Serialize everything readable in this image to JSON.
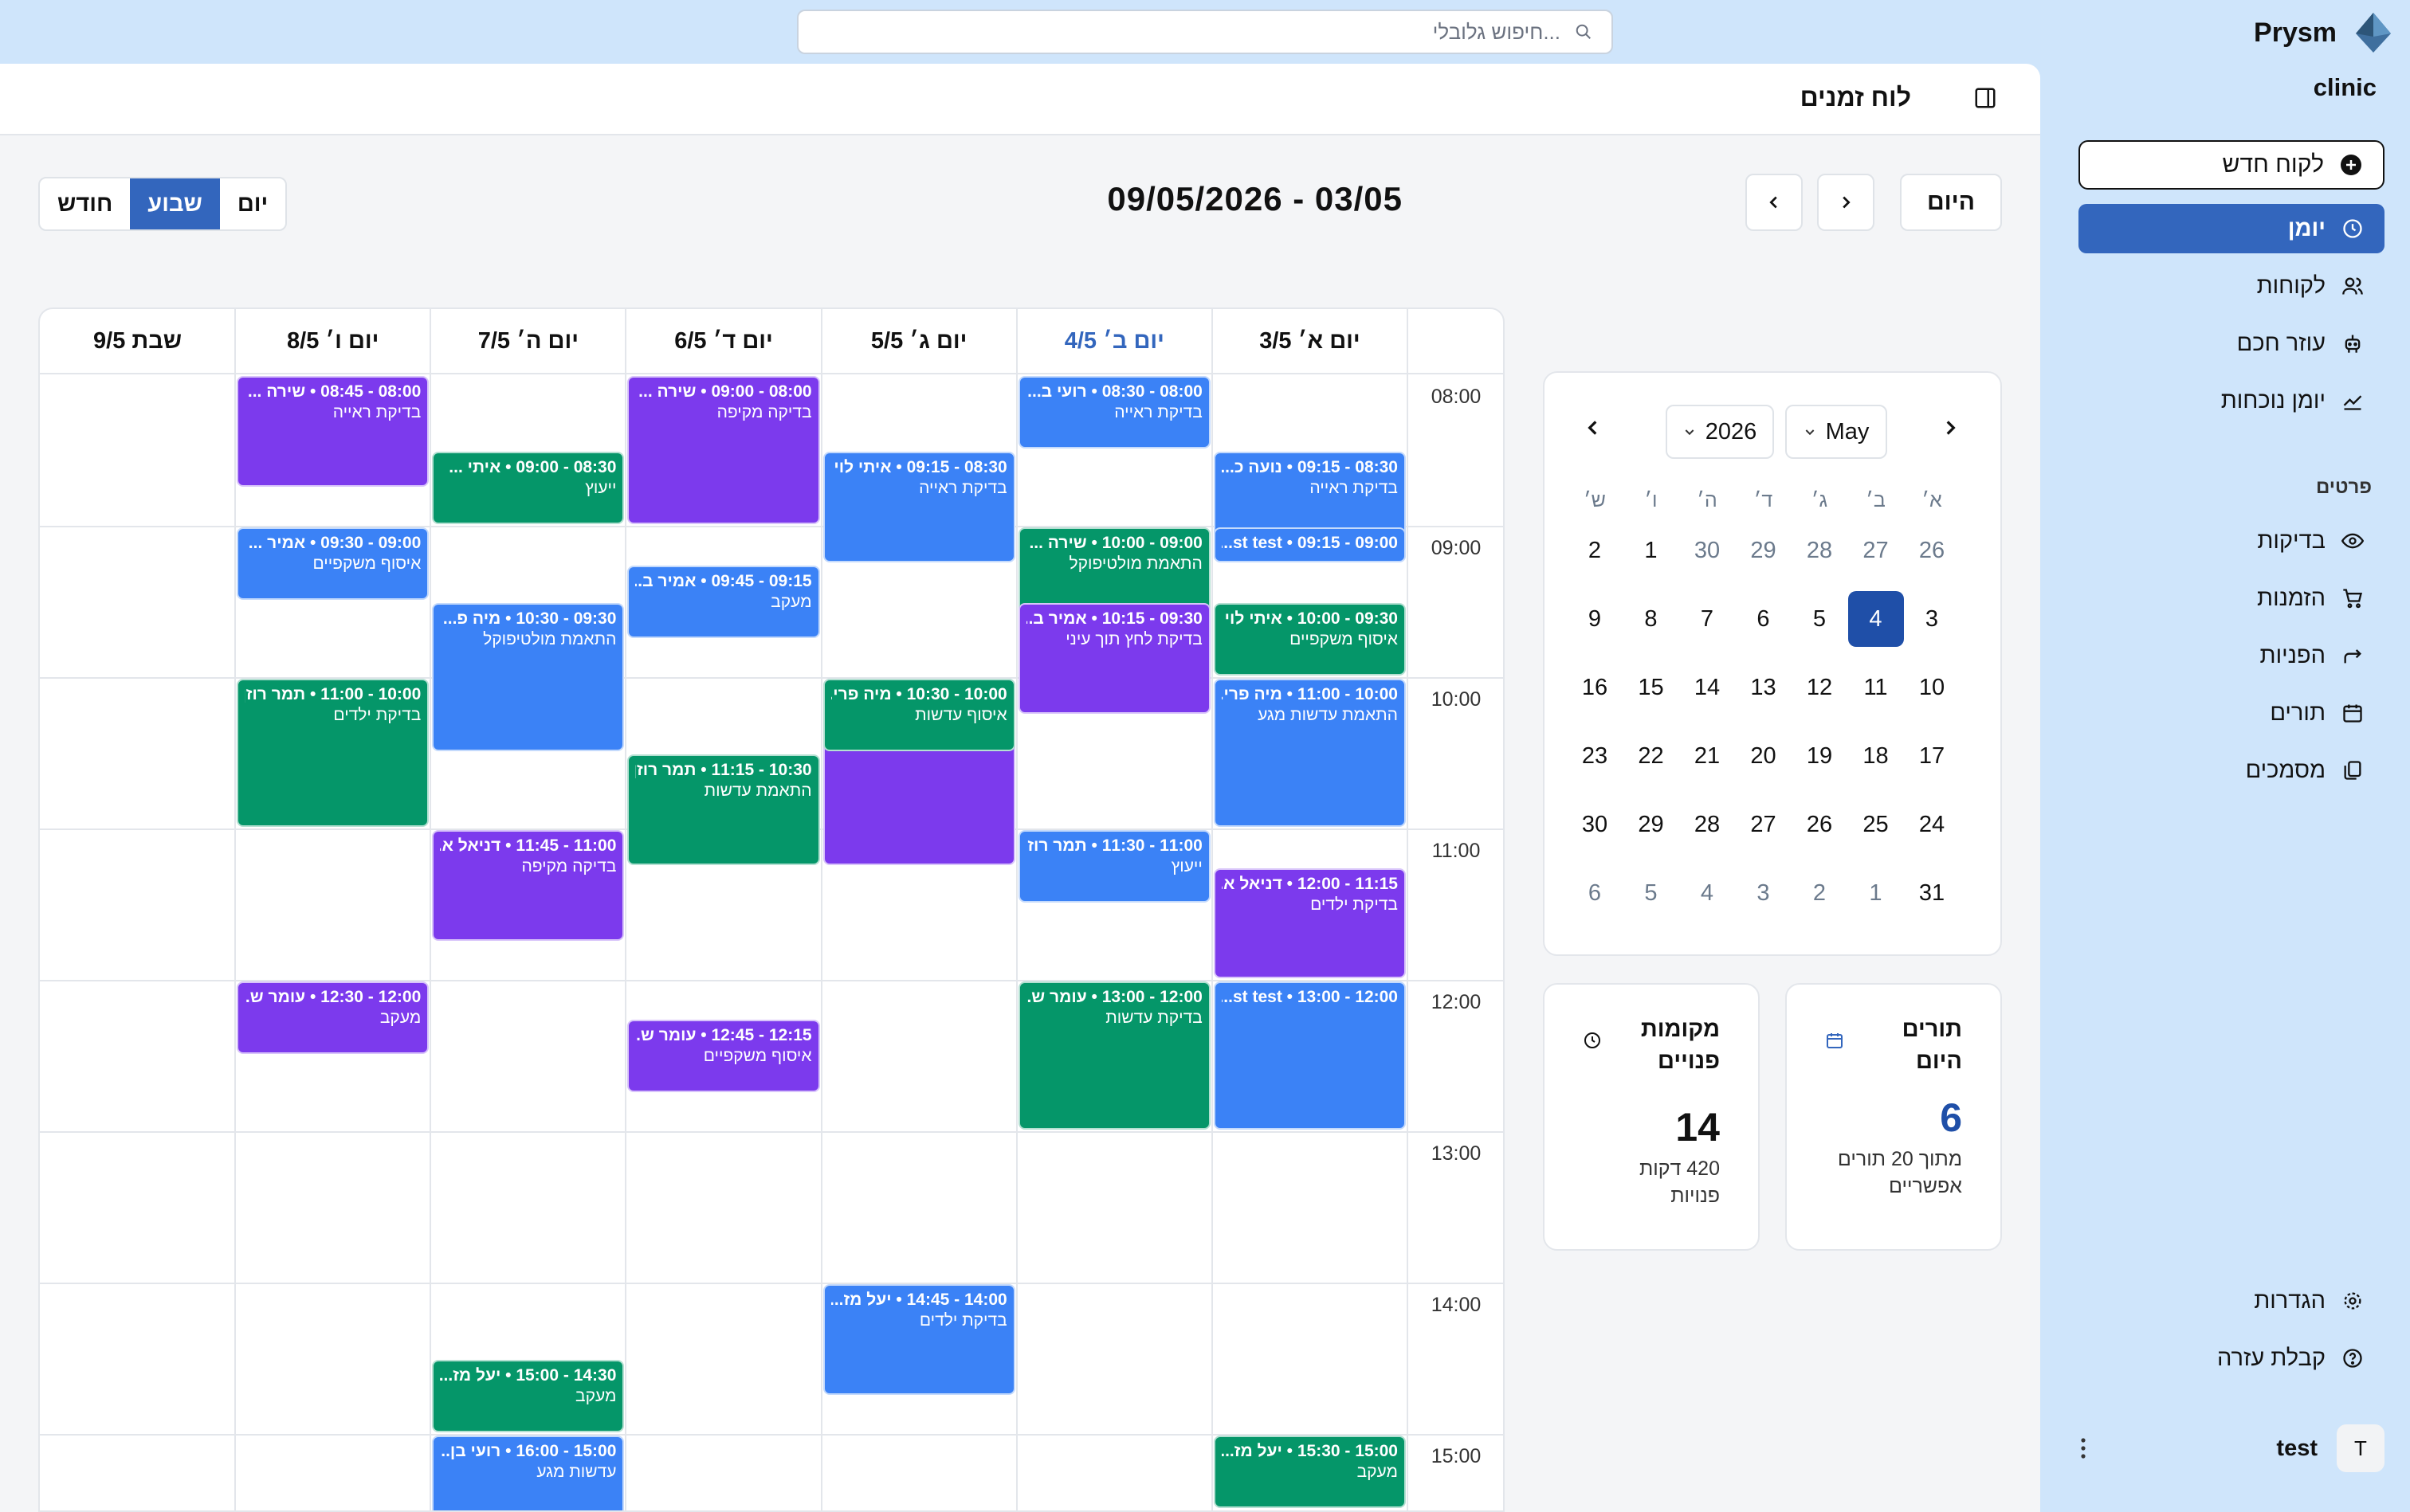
{
  "search": {
    "placeholder": "חיפוש גלובלי..."
  },
  "sidebar": {
    "brand": "Prysm",
    "clinic": "clinic",
    "new_client": "לקוח חדש",
    "nav": [
      {
        "label": "יומן",
        "icon": "calendar-clock-icon",
        "active": true
      },
      {
        "label": "לקוחות",
        "icon": "users-icon"
      },
      {
        "label": "עוזר חכם",
        "icon": "bot-icon"
      },
      {
        "label": "יומן נוכחות",
        "icon": "chart-line-icon"
      }
    ],
    "section_label": "פרטים",
    "details": [
      {
        "label": "בדיקות",
        "icon": "eye-icon"
      },
      {
        "label": "הזמנות",
        "icon": "cart-icon"
      },
      {
        "label": "הפניות",
        "icon": "redirect-icon"
      },
      {
        "label": "תורים",
        "icon": "calendar-icon"
      },
      {
        "label": "מסמכים",
        "icon": "documents-icon"
      }
    ],
    "footer": [
      {
        "label": "הגדרות",
        "icon": "gear-icon"
      },
      {
        "label": "קבלת עזרה",
        "icon": "help-icon"
      }
    ],
    "user": {
      "name": "test",
      "initial": "T"
    }
  },
  "header": {
    "title": "לוח זמנים"
  },
  "toolbar": {
    "range": "09/05/2026 - 03/05",
    "today": "היום",
    "views": [
      "יום",
      "שבוע",
      "חודש"
    ],
    "active_view": "שבוע"
  },
  "week": {
    "days": [
      "יום א׳ 3/5",
      "יום ב׳ 4/5",
      "יום ג׳ 5/5",
      "יום ד׳ 6/5",
      "יום ה׳ 7/5",
      "יום ו׳ 8/5",
      "שבת 9/5"
    ],
    "today_index": 1,
    "hours": [
      "08:00",
      "09:00",
      "10:00",
      "11:00",
      "12:00",
      "13:00",
      "14:00",
      "15:00"
    ],
    "events": [
      {
        "day": 0,
        "start": "08:30",
        "end": "09:15",
        "line1": "08:30 - 09:15 • נועה כ...",
        "line2": "בדיקת ראייה",
        "color": "blue"
      },
      {
        "day": 0,
        "start": "09:00",
        "end": "09:15",
        "line1": "09:00 - 09:15 • st test...",
        "line2": "",
        "color": "blue"
      },
      {
        "day": 0,
        "start": "09:30",
        "end": "10:00",
        "line1": "09:30 - 10:00 • איתי לוי",
        "line2": "איסוף משקפיים",
        "color": "green"
      },
      {
        "day": 0,
        "start": "10:00",
        "end": "11:00",
        "line1": "10:00 - 11:00 • מיה פרי...",
        "line2": "התאמת עדשות מגע",
        "color": "blue"
      },
      {
        "day": 0,
        "start": "11:15",
        "end": "12:00",
        "line1": "11:15 - 12:00 • דניאל א...",
        "line2": "בדיקת ילדים",
        "color": "purple"
      },
      {
        "day": 0,
        "start": "12:00",
        "end": "13:00",
        "line1": "12:00 - 13:00 • st test...",
        "line2": "",
        "color": "blue"
      },
      {
        "day": 0,
        "start": "15:00",
        "end": "15:30",
        "line1": "15:00 - 15:30 • יעל מז...",
        "line2": "מעקב",
        "color": "green"
      },
      {
        "day": 1,
        "start": "08:00",
        "end": "08:30",
        "line1": "08:00 - 08:30 • רועי ב...",
        "line2": "בדיקת ראייה",
        "color": "blue"
      },
      {
        "day": 1,
        "start": "09:00",
        "end": "10:00",
        "line1": "09:00 - 10:00 • שירה ...",
        "line2": "התאמת מולטיפוקל",
        "color": "green"
      },
      {
        "day": 1,
        "start": "09:30",
        "end": "10:15",
        "line1": "09:30 - 10:15 • אמיר ב...",
        "line2": "בדיקת לחץ תוך עיני",
        "color": "purple"
      },
      {
        "day": 1,
        "start": "11:00",
        "end": "11:30",
        "line1": "11:00 - 11:30 • תמר רוזן",
        "line2": "ייעוץ",
        "color": "blue"
      },
      {
        "day": 1,
        "start": "12:00",
        "end": "13:00",
        "line1": "12:00 - 13:00 • עומר ש...",
        "line2": "בדיקת עדשות",
        "color": "green"
      },
      {
        "day": 2,
        "start": "08:30",
        "end": "09:15",
        "line1": "08:30 - 09:15 • איתי לוי",
        "line2": "בדיקת ראייה",
        "color": "blue"
      },
      {
        "day": 2,
        "start": "10:00",
        "end": "11:15",
        "line1": "",
        "line2": "",
        "color": "purple"
      },
      {
        "day": 2,
        "start": "10:00",
        "end": "10:30",
        "line1": "10:00 - 10:30 • מיה פרי...",
        "line2": "איסוף עדשות",
        "color": "green"
      },
      {
        "day": 2,
        "start": "14:00",
        "end": "14:45",
        "line1": "14:00 - 14:45 • יעל מז...",
        "line2": "בדיקת ילדים",
        "color": "blue"
      },
      {
        "day": 3,
        "start": "08:00",
        "end": "09:00",
        "line1": "08:00 - 09:00 • שירה ...",
        "line2": "בדיקה מקיפה",
        "color": "purple"
      },
      {
        "day": 3,
        "start": "09:15",
        "end": "09:45",
        "line1": "09:15 - 09:45 • אמיר ב...",
        "line2": "מעקב",
        "color": "blue"
      },
      {
        "day": 3,
        "start": "10:30",
        "end": "11:15",
        "line1": "10:30 - 11:15 • תמר רוזן",
        "line2": "התאמת עדשות",
        "color": "green"
      },
      {
        "day": 3,
        "start": "12:15",
        "end": "12:45",
        "line1": "12:15 - 12:45 • עומר ש...",
        "line2": "איסוף משקפיים",
        "color": "purple"
      },
      {
        "day": 4,
        "start": "08:30",
        "end": "09:00",
        "line1": "08:30 - 09:00 • איתי ...",
        "line2": "ייעוץ",
        "color": "green"
      },
      {
        "day": 4,
        "start": "09:30",
        "end": "10:30",
        "line1": "09:30 - 10:30 • מיה פ...",
        "line2": "התאמת מולטיפוקל",
        "color": "blue"
      },
      {
        "day": 4,
        "start": "11:00",
        "end": "11:45",
        "line1": "11:00 - 11:45 • דניאל א...",
        "line2": "בדיקה מקיפה",
        "color": "purple"
      },
      {
        "day": 4,
        "start": "14:30",
        "end": "15:00",
        "line1": "14:30 - 15:00 • יעל מז...",
        "line2": "מעקב",
        "color": "green"
      },
      {
        "day": 4,
        "start": "15:00",
        "end": "16:00",
        "line1": "15:00 - 16:00 • רועי בן...",
        "line2": "עדשות מגע",
        "color": "blue"
      },
      {
        "day": 5,
        "start": "08:00",
        "end": "08:45",
        "line1": "08:00 - 08:45 • שירה ...",
        "line2": "בדיקת ראייה",
        "color": "purple"
      },
      {
        "day": 5,
        "start": "09:00",
        "end": "09:30",
        "line1": "09:00 - 09:30 • אמיר ...",
        "line2": "איסוף משקפיים",
        "color": "blue"
      },
      {
        "day": 5,
        "start": "10:00",
        "end": "11:00",
        "line1": "10:00 - 11:00 • תמר רוזן",
        "line2": "בדיקת ילדים",
        "color": "green"
      },
      {
        "day": 5,
        "start": "12:00",
        "end": "12:30",
        "line1": "12:00 - 12:30 • עומר ש...",
        "line2": "מעקב",
        "color": "purple"
      }
    ]
  },
  "minical": {
    "month": "May",
    "year": "2026",
    "weekdays": [
      "א׳",
      "ב׳",
      "ג׳",
      "ד׳",
      "ה׳",
      "ו׳",
      "ש׳"
    ],
    "weeks": [
      [
        "26",
        "27",
        "28",
        "29",
        "30",
        "1",
        "2"
      ],
      [
        "3",
        "4",
        "5",
        "6",
        "7",
        "8",
        "9"
      ],
      [
        "10",
        "11",
        "12",
        "13",
        "14",
        "15",
        "16"
      ],
      [
        "17",
        "18",
        "19",
        "20",
        "21",
        "22",
        "23"
      ],
      [
        "24",
        "25",
        "26",
        "27",
        "28",
        "29",
        "30"
      ],
      [
        "31",
        "1",
        "2",
        "3",
        "4",
        "5",
        "6"
      ]
    ],
    "selected": "4"
  },
  "cards": {
    "appointments": {
      "title": "תורים היום",
      "value": "6",
      "sub": "מתוך 20 תורים אפשריים"
    },
    "free_slots": {
      "title": "מקומות פנויים",
      "value": "14",
      "sub": "420 דקות פנויות"
    }
  },
  "colors": {
    "accent": "#3366bd",
    "purple": "#7c3aed",
    "blue": "#3b82f6",
    "green": "#059669"
  }
}
